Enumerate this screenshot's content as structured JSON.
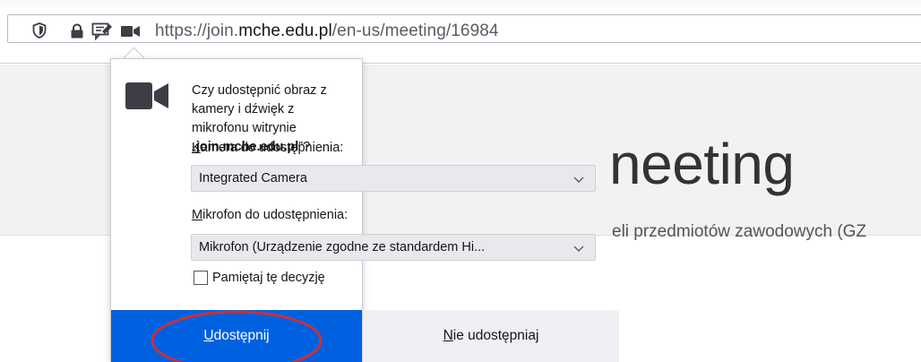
{
  "browser": {
    "url_prefix": "https://join.",
    "url_host": "mche.edu.pl",
    "url_suffix": "/en-us/meeting/16984"
  },
  "page": {
    "title": "neeting",
    "subtitle": "eli przedmiotów zawodowych (GZ"
  },
  "popup": {
    "message_part1": "Czy udostępnić obraz z kamery i dźwięk z mikrofonu witrynie „",
    "message_host": "join.mche.edu.pl",
    "message_part2": "”?",
    "camera_label_access": "K",
    "camera_label_rest": "amera do udostępnienia:",
    "camera_value": "Integrated Camera",
    "mic_label_access": "M",
    "mic_label_rest": "ikrofon do udostępnienia:",
    "mic_value": "Mikrofon (Urządzenie zgodne ze standardem Hi...",
    "remember_label": "Pamiętaj tę decyzję",
    "allow_access": "U",
    "allow_rest": "dostępnij",
    "deny_access": "N",
    "deny_rest": "ie udostępniaj"
  },
  "colors": {
    "allow_button": "#0061e0",
    "annotation": "#c8323a"
  },
  "icons": {
    "shield": "shield-icon",
    "lock": "lock-icon",
    "permissions": "permissions-icon",
    "camera": "camera-icon",
    "chevron": "chevron-down-icon"
  }
}
